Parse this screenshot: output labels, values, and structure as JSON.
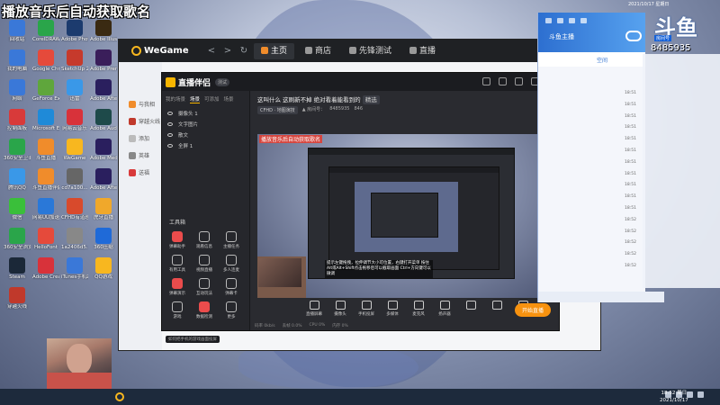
{
  "overlay_title": "播放音乐后自动获取歌名",
  "desktop_icons": [
    {
      "label": "回收站",
      "color": "#3a78d8"
    },
    {
      "label": "CorelDRAW 2020",
      "color": "#2aa54a"
    },
    {
      "label": "Adobe Photosho...",
      "color": "#1c3b6e"
    },
    {
      "label": "Adobe Illustra...",
      "color": "#3a2a12"
    },
    {
      "label": "我的电脑",
      "color": "#3a78d8"
    },
    {
      "label": "Google Chrome",
      "color": "#e54a3b"
    },
    {
      "label": "SketchUp 2020",
      "color": "#c63a2c"
    },
    {
      "label": "Adobe Premiere",
      "color": "#3a1e5a"
    },
    {
      "label": "网络",
      "color": "#3a78d8"
    },
    {
      "label": "GeForce Experience",
      "color": "#5fa63c"
    },
    {
      "label": "迅雷",
      "color": "#3a98e8"
    },
    {
      "label": "Adobe After...",
      "color": "#2a1f5e"
    },
    {
      "label": "控制面板",
      "color": "#d83a3a"
    },
    {
      "label": "Microsoft Edge",
      "color": "#1f8ad8"
    },
    {
      "label": "网易云音乐",
      "color": "#d8323a"
    },
    {
      "label": "Adobe Audition",
      "color": "#1e4a4a"
    },
    {
      "label": "360安全卫士",
      "color": "#2aa54a"
    },
    {
      "label": "斗鱼直播",
      "color": "#f08c2b"
    },
    {
      "label": "WeGame",
      "color": "#f8b71f"
    },
    {
      "label": "Adobe Media...",
      "color": "#2a1f5e"
    },
    {
      "label": "腾讯QQ",
      "color": "#3a98e8"
    },
    {
      "label": "斗鱼直播伴侣",
      "color": "#f08c2b"
    },
    {
      "label": "cd7a100...",
      "color": "#666"
    },
    {
      "label": "Adobe After Effects",
      "color": "#2a1f5e"
    },
    {
      "label": "微信",
      "color": "#3abf3a"
    },
    {
      "label": "网易UU加速",
      "color": "#2a78d8"
    },
    {
      "label": "CFHD有道理",
      "color": "#d84a2c"
    },
    {
      "label": "虎牙直播",
      "color": "#f0a82b"
    },
    {
      "label": "360安全浏览器",
      "color": "#2aa54a"
    },
    {
      "label": "HelloFont",
      "color": "#e54a3b"
    },
    {
      "label": "1a2406d5...",
      "color": "#888"
    },
    {
      "label": "360压缩",
      "color": "#1f6ad8"
    },
    {
      "label": "Steam",
      "color": "#1b2838"
    },
    {
      "label": "Adobe Creati...",
      "color": "#d8323a"
    },
    {
      "label": "iTunes手机助手",
      "color": "#3a78d8"
    },
    {
      "label": "QQ游戏",
      "color": "#f8b71f"
    },
    {
      "label": "穿越火线",
      "color": "#c0392b"
    }
  ],
  "wegame": {
    "logo": "WeGame",
    "nav_back": "<",
    "nav_fwd": ">",
    "nav_refresh": "↻",
    "tabs": [
      {
        "label": "主页",
        "active": true
      },
      {
        "label": "商店",
        "active": false
      },
      {
        "label": "先锋测试",
        "active": false
      },
      {
        "label": "直播",
        "active": false
      }
    ],
    "side_items": [
      {
        "label": "与我相",
        "color": "#f08c2b"
      },
      {
        "label": "穿越火线",
        "color": "#c0392b"
      },
      {
        "label": "添加",
        "color": "#999"
      },
      {
        "label": "英雄",
        "color": "#888"
      },
      {
        "label": "送福",
        "color": "#d83a3a"
      }
    ]
  },
  "live": {
    "logo": "直播伴侣",
    "version": "测试",
    "left_tabs": [
      {
        "label": "我的场景",
        "active": false
      },
      {
        "label": "场景",
        "active": true
      },
      {
        "label": "可添加",
        "active": false
      },
      {
        "label": "场景",
        "active": false
      }
    ],
    "scenes": [
      "摄像头 1",
      "文字图片",
      "散文",
      "全屏 1"
    ],
    "tools_title": "工具箱",
    "tools": [
      {
        "label": "弹幕助手",
        "red": true
      },
      {
        "label": "观看信息",
        "red": false
      },
      {
        "label": "主播任务",
        "red": false
      },
      {
        "label": "有用工具",
        "red": false
      },
      {
        "label": "视频直播",
        "red": false
      },
      {
        "label": "多人连麦",
        "red": false
      },
      {
        "label": "弹幕演示",
        "red": true
      },
      {
        "label": "互动玩法",
        "red": false
      },
      {
        "label": "弹幕卡",
        "red": false
      },
      {
        "label": "游戏",
        "red": false
      },
      {
        "label": "数据检测",
        "red": true
      },
      {
        "label": "更多",
        "red": false
      }
    ],
    "tip": "如何把手机的游戏画面投屏",
    "room_title": "这叫什么 这刷新不掉 绝对看着能看到的",
    "room_tag": "精选",
    "room_pill": "CFHD · 地图演技",
    "room_sub": "▲ 房间号：",
    "room_id": "8485935",
    "room_count": "846",
    "preview_title": "播放音乐后自动获取歌名",
    "preview_caption": "提示左键拖拽，拉伸调节大小可位置，右键打开菜单 按住Alt或Alt+Shift点击拖移后可以截取画面 Ctrl+方向键可以微调",
    "controls": [
      "直播屏幕",
      "摄像头",
      "手机投屏",
      "多媒体",
      "麦克风",
      "扬声器",
      "",
      "",
      ""
    ],
    "live_button": "开始直播",
    "status": [
      "码率 0kb/s",
      "丢帧 0.0%",
      "CPU 0%",
      "内存 0%"
    ]
  },
  "chat": {
    "name": "斗鱼主播",
    "sub_label": "空间",
    "times": [
      "18:51",
      "18:51",
      "18:51",
      "18:51",
      "18:51",
      "18:51",
      "18:51",
      "18:51",
      "18:51",
      "18:51",
      "18:51",
      "18:52",
      "18:52",
      "18:52",
      "18:52",
      "18:52"
    ]
  },
  "douyu": {
    "big": "斗鱼",
    "tag": "房间号",
    "number": "8485935"
  },
  "top_right": "2021/10/17 星期日",
  "taskbar": {
    "time": "18:52 周日",
    "date": "2021/10/17"
  }
}
